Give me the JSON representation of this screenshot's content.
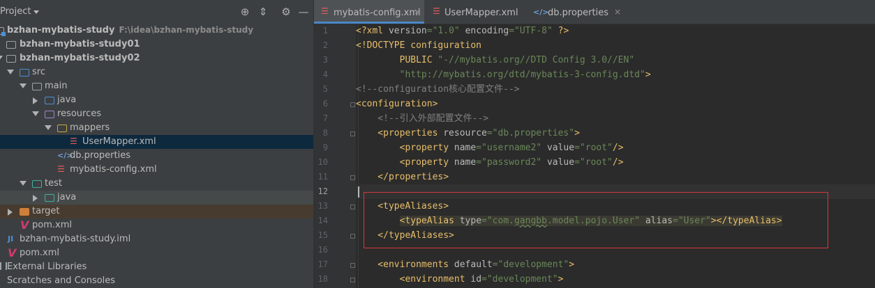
{
  "project_panel": {
    "title": "Project",
    "tree": [
      {
        "label": "bzhan-mybatis-study",
        "path": "F:\\idea\\bzhan-mybatis-study",
        "bold": true
      },
      {
        "label": "bzhan-mybatis-study01",
        "bold": true
      },
      {
        "label": "bzhan-mybatis-study02",
        "bold": true
      },
      {
        "label": "src"
      },
      {
        "label": "main"
      },
      {
        "label": "java"
      },
      {
        "label": "resources"
      },
      {
        "label": "mappers"
      },
      {
        "label": "UserMapper.xml"
      },
      {
        "label": "db.properties"
      },
      {
        "label": "mybatis-config.xml"
      },
      {
        "label": "test"
      },
      {
        "label": "java"
      },
      {
        "label": "target"
      },
      {
        "label": "pom.xml"
      },
      {
        "label": "bzhan-mybatis-study.iml"
      },
      {
        "label": "pom.xml"
      },
      {
        "label": "External Libraries"
      },
      {
        "label": "Scratches and Consoles"
      }
    ]
  },
  "tabs": [
    {
      "label": "mybatis-config.xml",
      "icon": "xml-icon",
      "active": true,
      "close": "×"
    },
    {
      "label": "UserMapper.xml",
      "icon": "xml-icon",
      "active": false,
      "close": "×"
    },
    {
      "label": "db.properties",
      "icon": "properties-icon",
      "active": false,
      "close": "×"
    }
  ],
  "editor": {
    "current_line": 12,
    "lines": [
      {
        "n": "1",
        "parts": [
          [
            "tg",
            "<?xml "
          ],
          [
            "at",
            "version"
          ],
          [
            "vl",
            "=\"1.0\" "
          ],
          [
            "at",
            "encoding"
          ],
          [
            "vl",
            "=\"UTF-8\" "
          ],
          [
            "tg",
            "?>"
          ]
        ]
      },
      {
        "n": "2",
        "parts": [
          [
            "tg",
            "<!DOCTYPE configuration"
          ]
        ]
      },
      {
        "n": "3",
        "parts": [
          [
            "tg",
            "        PUBLIC "
          ],
          [
            "vl",
            "\"-//mybatis.org//DTD Config 3.0//EN\""
          ]
        ]
      },
      {
        "n": "4",
        "parts": [
          [
            "vl",
            "        \"http://mybatis.org/dtd/mybatis-3-config.dtd\""
          ],
          [
            "tg",
            ">"
          ]
        ]
      },
      {
        "n": "5",
        "parts": [
          [
            "cm",
            "<!--configuration核心配置文件-->"
          ]
        ]
      },
      {
        "n": "6",
        "parts": [
          [
            "tg",
            "<configuration>"
          ]
        ]
      },
      {
        "n": "7",
        "parts": [
          [
            "cm",
            "    <!--引入外部配置文件-->"
          ]
        ]
      },
      {
        "n": "8",
        "parts": [
          [
            "tg",
            "    <properties "
          ],
          [
            "at",
            "resource"
          ],
          [
            "vl",
            "=\"db.properties\""
          ],
          [
            "tg",
            ">"
          ]
        ]
      },
      {
        "n": "9",
        "parts": [
          [
            "tg",
            "        <property "
          ],
          [
            "at",
            "name"
          ],
          [
            "vl",
            "=\"username2\" "
          ],
          [
            "at",
            "value"
          ],
          [
            "vl",
            "=\"root\""
          ],
          [
            "tg",
            "/>"
          ]
        ]
      },
      {
        "n": "10",
        "parts": [
          [
            "tg",
            "        <property "
          ],
          [
            "at",
            "name"
          ],
          [
            "vl",
            "=\"password2\" "
          ],
          [
            "at",
            "value"
          ],
          [
            "vl",
            "=\"root\""
          ],
          [
            "tg",
            "/>"
          ]
        ]
      },
      {
        "n": "11",
        "parts": [
          [
            "tg",
            "    </properties>"
          ]
        ]
      },
      {
        "n": "12",
        "parts": []
      },
      {
        "n": "13",
        "parts": [
          [
            "tg",
            "    <typeAliases>"
          ]
        ]
      },
      {
        "n": "14",
        "parts": [
          [
            "pl",
            "        "
          ],
          [
            "tgh",
            "<typeAlias "
          ],
          [
            "ath",
            "type"
          ],
          [
            "vlh",
            "=\"com."
          ],
          [
            "vlsq",
            "gangbb"
          ],
          [
            "vlh",
            ".model.pojo.User\" "
          ],
          [
            "ath",
            "alias"
          ],
          [
            "vlh",
            "=\"User\""
          ],
          [
            "tgh",
            "></typeAlias>"
          ]
        ]
      },
      {
        "n": "15",
        "parts": [
          [
            "tg",
            "    </typeAliases>"
          ]
        ]
      },
      {
        "n": "16",
        "parts": []
      },
      {
        "n": "17",
        "parts": [
          [
            "tg",
            "    <environments "
          ],
          [
            "at",
            "default"
          ],
          [
            "vl",
            "=\"development\""
          ],
          [
            "tg",
            ">"
          ]
        ]
      },
      {
        "n": "18",
        "parts": [
          [
            "tg",
            "        <environment "
          ],
          [
            "at",
            "id"
          ],
          [
            "vl",
            "=\"development\""
          ],
          [
            "tg",
            ">"
          ]
        ]
      }
    ]
  },
  "colors": {
    "tag": "#e8bf6a",
    "attr": "#bababa",
    "value": "#6a8759",
    "comment": "#808080",
    "highlight_box": "#d5393a"
  }
}
